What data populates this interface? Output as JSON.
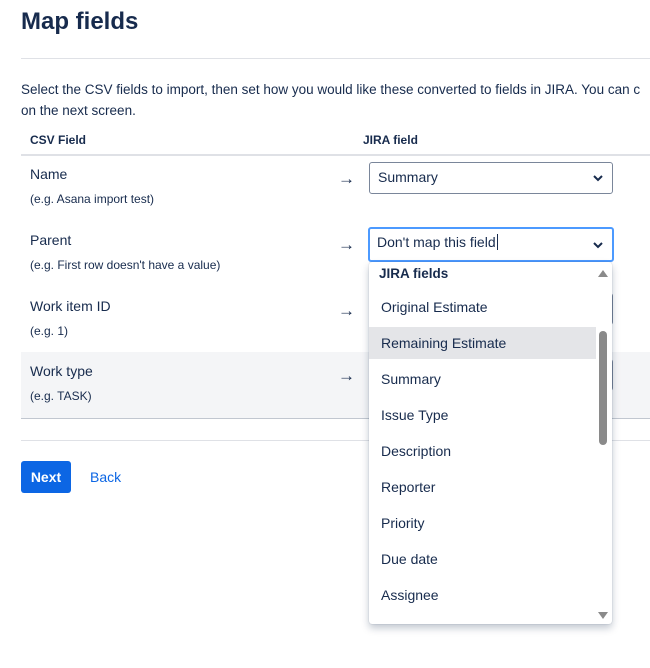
{
  "page": {
    "title": "Map fields",
    "description_line1": "Select the CSV fields to import, then set how you would like these converted to fields in JIRA. You can c",
    "description_line2": "on the next screen."
  },
  "table": {
    "header_csv": "CSV Field",
    "header_jira": "JIRA field",
    "arrow": "→",
    "rows": [
      {
        "name": "Name",
        "example": "(e.g. Asana import test)",
        "jira_value": "Summary"
      },
      {
        "name": "Parent",
        "example": "(e.g. First row doesn't have a value)",
        "jira_value": "Don't map this field"
      },
      {
        "name": "Work item ID",
        "example": "(e.g. 1)",
        "jira_value": ""
      },
      {
        "name": "Work type",
        "example": "(e.g. TASK)",
        "jira_value": ""
      }
    ]
  },
  "dropdown": {
    "group_label": "JIRA fields",
    "hovered_index": 1,
    "items": [
      "Original Estimate",
      "Remaining Estimate",
      "Summary",
      "Issue Type",
      "Description",
      "Reporter",
      "Priority",
      "Due date",
      "Assignee"
    ]
  },
  "actions": {
    "next_label": "Next",
    "back_label": "Back"
  },
  "colors": {
    "primary": "#0c66e4",
    "focus_ring": "#4c9aff",
    "text": "#172b4d",
    "row_shade": "#f4f5f7"
  }
}
